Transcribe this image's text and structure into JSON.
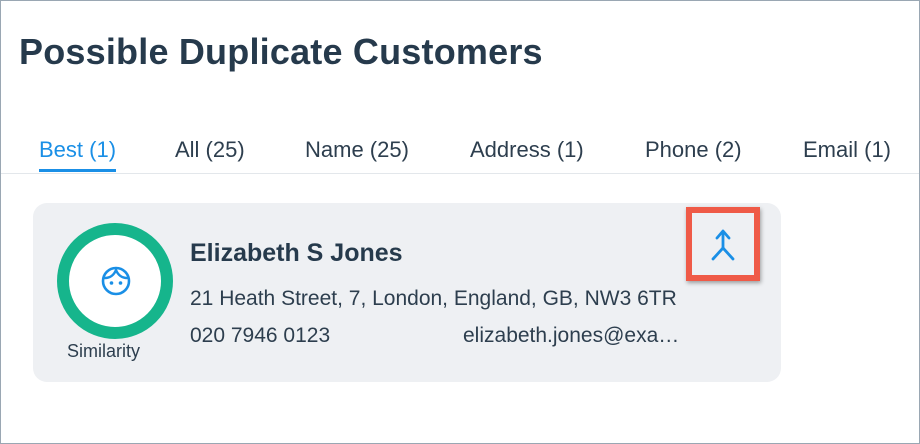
{
  "page": {
    "title": "Possible Duplicate Customers"
  },
  "tabs": [
    {
      "label": "Best (1)",
      "active": true
    },
    {
      "label": "All (25)",
      "active": false
    },
    {
      "label": "Name (25)",
      "active": false
    },
    {
      "label": "Address (1)",
      "active": false
    },
    {
      "label": "Phone (2)",
      "active": false
    },
    {
      "label": "Email (1)",
      "active": false
    }
  ],
  "results": [
    {
      "name": "Elizabeth S Jones",
      "address": "21 Heath Street, 7, London, England, GB, NW3 6TR",
      "phone": "020 7946 0123",
      "email": "elizabeth.jones@exa…",
      "similarity_label": "Similarity",
      "avatar_icon": "person-face-icon",
      "action_icon": "merge-icon"
    }
  ],
  "colors": {
    "accent": "#1a8fe6",
    "similarity_ring": "#16b58c",
    "highlight": "#ef5a47",
    "card_bg": "#eef0f3"
  }
}
